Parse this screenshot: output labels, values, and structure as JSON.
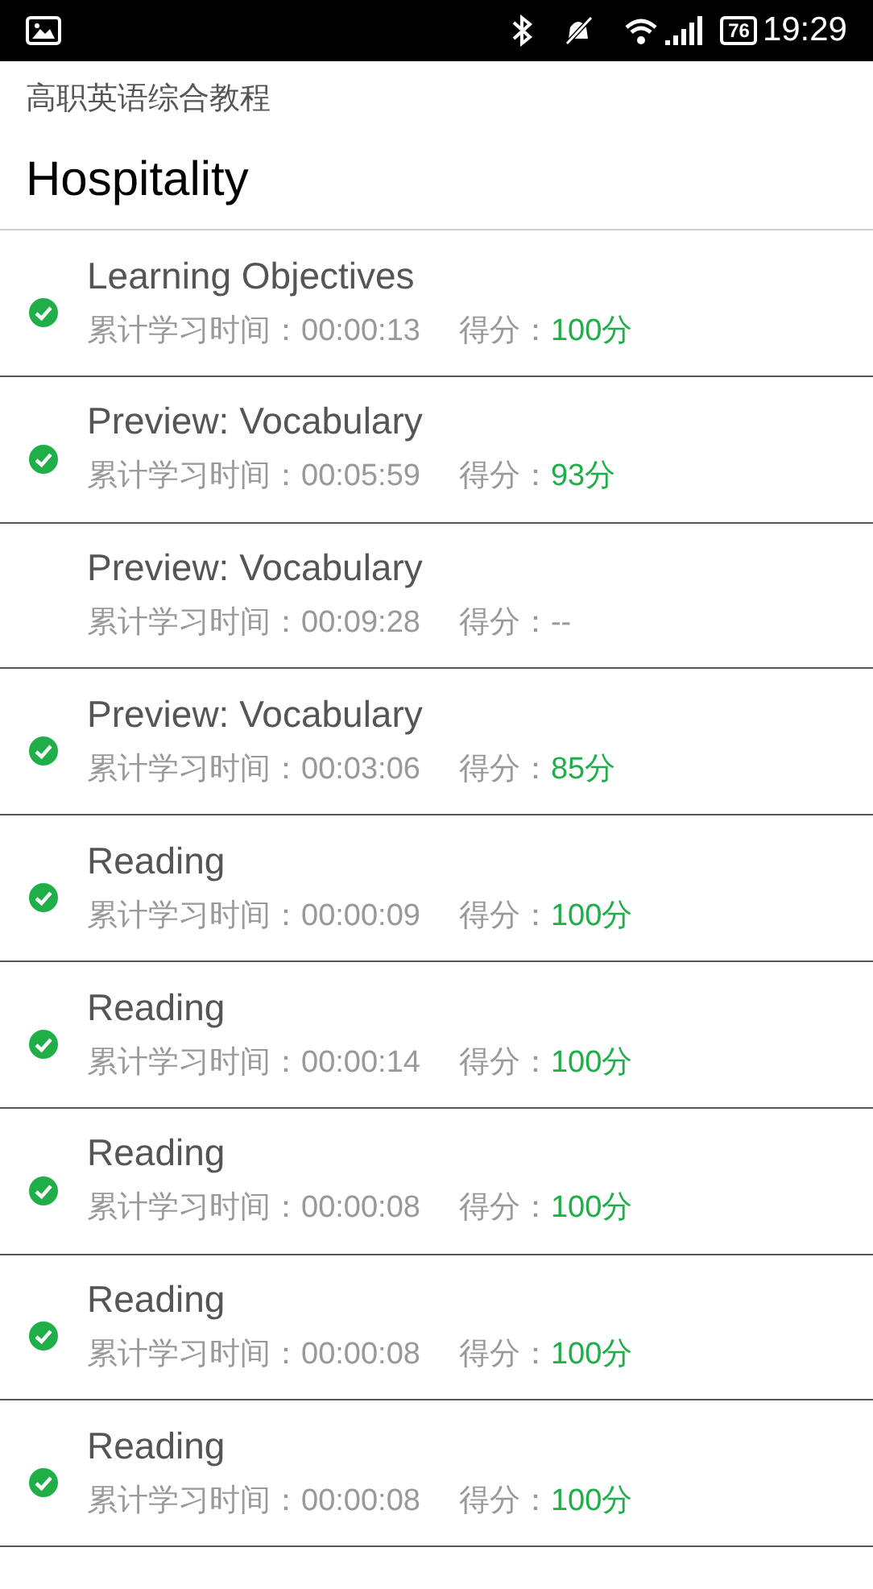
{
  "status_bar": {
    "battery": "76",
    "time": "19:29"
  },
  "header": {
    "subtitle": "高职英语综合教程",
    "title": "Hospitality"
  },
  "items": [
    {
      "title": "Learning Objectives",
      "time": "累计学习时间：00:00:13",
      "score_label": "得分：",
      "score": "100分",
      "completed": true
    },
    {
      "title": "Preview: Vocabulary",
      "time": "累计学习时间：00:05:59",
      "score_label": "得分：",
      "score": "93分",
      "completed": true
    },
    {
      "title": "Preview: Vocabulary",
      "time": "累计学习时间：00:09:28",
      "score_label": "得分：",
      "score": "--",
      "completed": false
    },
    {
      "title": "Preview: Vocabulary",
      "time": "累计学习时间：00:03:06",
      "score_label": "得分：",
      "score": "85分",
      "completed": true
    },
    {
      "title": "Reading",
      "time": "累计学习时间：00:00:09",
      "score_label": "得分：",
      "score": "100分",
      "completed": true
    },
    {
      "title": "Reading",
      "time": "累计学习时间：00:00:14",
      "score_label": "得分：",
      "score": "100分",
      "completed": true
    },
    {
      "title": "Reading",
      "time": "累计学习时间：00:00:08",
      "score_label": "得分：",
      "score": "100分",
      "completed": true
    },
    {
      "title": "Reading",
      "time": "累计学习时间：00:00:08",
      "score_label": "得分：",
      "score": "100分",
      "completed": true
    },
    {
      "title": "Reading",
      "time": "累计学习时间：00:00:08",
      "score_label": "得分：",
      "score": "100分",
      "completed": true
    }
  ]
}
